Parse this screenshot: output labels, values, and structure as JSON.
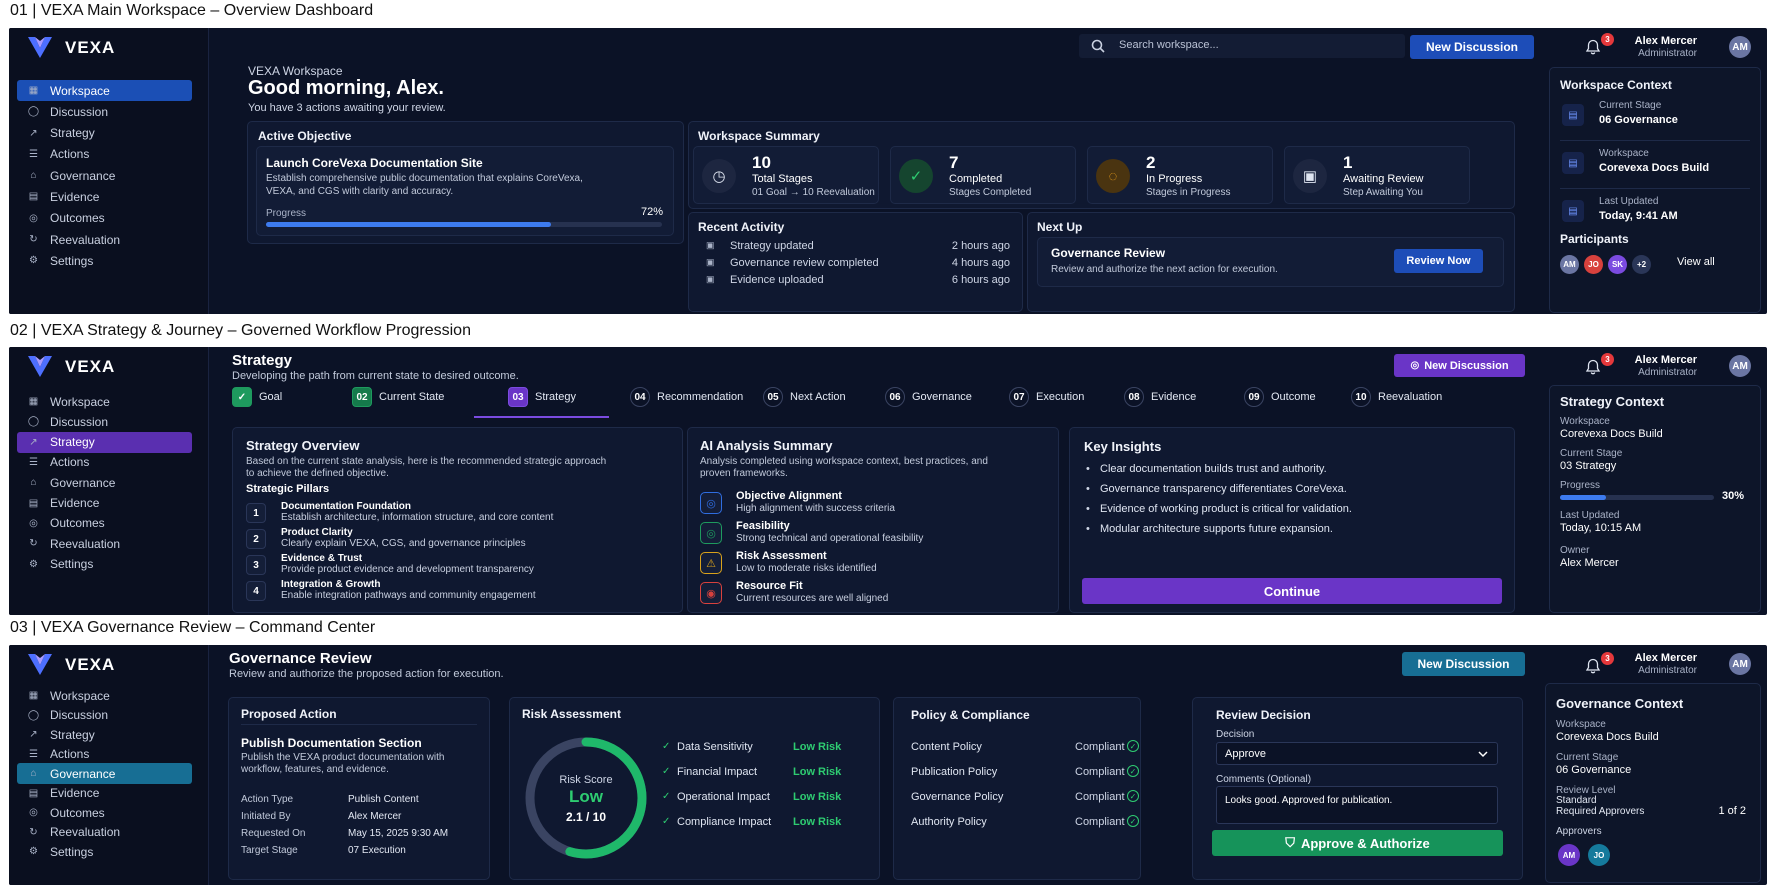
{
  "colors": {
    "blue": "#2f6de0",
    "purple": "#6a35c7",
    "teal": "#157a9c",
    "green": "#1e9a5e",
    "risk_green": "#2ecc71",
    "panel_bg": "#0b1226"
  },
  "brand": "VEXA",
  "nav_items": [
    "Workspace",
    "Discussion",
    "Strategy",
    "Actions",
    "Governance",
    "Evidence",
    "Outcomes",
    "Reevaluation",
    "Settings"
  ],
  "user": {
    "name": "Alex Mercer",
    "role": "Administrator",
    "initials": "AM",
    "notifications": "3"
  },
  "s1": {
    "title": "01  |  VEXA Main Workspace – Overview Dashboard",
    "search_placeholder": "Search workspace...",
    "new_discussion": "New Discussion",
    "eyebrow": "VEXA Workspace",
    "greeting": "Good morning, Alex.",
    "subtext": "You have 3 actions awaiting your review.",
    "objective": {
      "header": "Active Objective",
      "title": "Launch CoreVexa Documentation Site",
      "desc1": "Establish comprehensive public documentation that explains CoreVexa,",
      "desc2": "VEXA, and CGS with clarity and accuracy.",
      "progress_label": "Progress",
      "progress_value": "72%",
      "progress": 0.72
    },
    "summary": {
      "header": "Workspace Summary",
      "stats": [
        {
          "value": "10",
          "label": "Total Stages",
          "sub": "01 Goal → 10 Reevaluation",
          "icon": "stages-icon"
        },
        {
          "value": "7",
          "label": "Completed",
          "sub": "Stages Completed",
          "icon": "check-icon"
        },
        {
          "value": "2",
          "label": "In Progress",
          "sub": "Stages in Progress",
          "icon": "progress-icon"
        },
        {
          "value": "1",
          "label": "Awaiting Review",
          "sub": "Step Awaiting You",
          "icon": "review-icon"
        }
      ]
    },
    "activity": {
      "header": "Recent Activity",
      "items": [
        {
          "text": "Strategy updated",
          "time": "2 hours ago"
        },
        {
          "text": "Governance review completed",
          "time": "4 hours ago"
        },
        {
          "text": "Evidence uploaded",
          "time": "6 hours ago"
        }
      ]
    },
    "next": {
      "header": "Next Up",
      "title": "Governance Review",
      "desc": "Review and authorize the next action for execution.",
      "button": "Review Now"
    },
    "context": {
      "header": "Workspace Context",
      "items": [
        {
          "label": "Current Stage",
          "value": "06 Governance"
        },
        {
          "label": "Workspace",
          "value": "Corevexa Docs Build"
        },
        {
          "label": "Last Updated",
          "value": "Today, 9:41 AM"
        }
      ],
      "participants_label": "Participants",
      "participants": [
        "AM",
        "JO",
        "SK",
        "+2"
      ],
      "view_all": "View all"
    }
  },
  "s2": {
    "title": "02  |  VEXA Strategy & Journey – Governed Workflow Progression",
    "header": "Strategy",
    "subheader": "Developing the path from current state to desired outcome.",
    "new_discussion": "New Discussion",
    "steps": [
      {
        "num": "✓",
        "label": "Goal"
      },
      {
        "num": "02",
        "label": "Current State"
      },
      {
        "num": "03",
        "label": "Strategy"
      },
      {
        "num": "04",
        "label": "Recommendation"
      },
      {
        "num": "05",
        "label": "Next Action"
      },
      {
        "num": "06",
        "label": "Governance"
      },
      {
        "num": "07",
        "label": "Execution"
      },
      {
        "num": "08",
        "label": "Evidence"
      },
      {
        "num": "09",
        "label": "Outcome"
      },
      {
        "num": "10",
        "label": "Reevaluation"
      }
    ],
    "overview": {
      "header": "Strategy Overview",
      "desc1": "Based on the current state analysis, here is the recommended strategic approach",
      "desc2": "to achieve the defined objective.",
      "pillars_label": "Strategic Pillars",
      "pillars": [
        {
          "n": "1",
          "title": "Documentation Foundation",
          "desc": "Establish architecture, information structure, and core content"
        },
        {
          "n": "2",
          "title": "Product Clarity",
          "desc": "Clearly explain VEXA, CGS, and governance principles"
        },
        {
          "n": "3",
          "title": "Evidence & Trust",
          "desc": "Provide product evidence and development transparency"
        },
        {
          "n": "4",
          "title": "Integration & Growth",
          "desc": "Enable integration pathways and community engagement"
        }
      ]
    },
    "ai": {
      "header": "AI Analysis Summary",
      "desc1": "Analysis completed using workspace context, best practices, and",
      "desc2": "proven frameworks.",
      "items": [
        {
          "title": "Objective Alignment",
          "desc": "High alignment with success criteria",
          "color": "#2f6de0"
        },
        {
          "title": "Feasibility",
          "desc": "Strong technical and operational feasibility",
          "color": "#1e9a5e"
        },
        {
          "title": "Risk Assessment",
          "desc": "Low to moderate risks identified",
          "color": "#d9a21b"
        },
        {
          "title": "Resource Fit",
          "desc": "Current resources are well aligned",
          "color": "#d8413d"
        }
      ]
    },
    "insights": {
      "header": "Key Insights",
      "items": [
        "Clear documentation builds trust and authority.",
        "Governance transparency differentiates CoreVexa.",
        "Evidence of working product is critical for validation.",
        "Modular architecture supports future expansion."
      ],
      "button": "Continue"
    },
    "context": {
      "header": "Strategy Context",
      "workspace_label": "Workspace",
      "workspace": "Corevexa Docs Build",
      "stage_label": "Current Stage",
      "stage": "03 Strategy",
      "progress_label": "Progress",
      "progress_value": "30%",
      "progress": 0.3,
      "updated_label": "Last Updated",
      "updated": "Today, 10:15 AM",
      "owner_label": "Owner",
      "owner": "Alex Mercer"
    }
  },
  "s3": {
    "title": "03  |  VEXA Governance Review – Command Center",
    "header": "Governance Review",
    "subheader": "Review and authorize the proposed action for execution.",
    "new_discussion": "New Discussion",
    "proposed": {
      "header": "Proposed Action",
      "title": "Publish Documentation Section",
      "desc1": "Publish the VEXA product documentation with",
      "desc2": "workflow, features, and evidence.",
      "rows": [
        {
          "k": "Action Type",
          "v": "Publish Content"
        },
        {
          "k": "Initiated By",
          "v": "Alex Mercer"
        },
        {
          "k": "Requested On",
          "v": "May 15, 2025 9:30 AM"
        },
        {
          "k": "Target Stage",
          "v": "07 Execution"
        }
      ]
    },
    "risk": {
      "header": "Risk Assessment",
      "score_label": "Risk Score",
      "level": "Low",
      "score": "2.1 / 10",
      "score_value": 2.1,
      "items": [
        {
          "k": "Data Sensitivity",
          "v": "Low Risk"
        },
        {
          "k": "Financial Impact",
          "v": "Low Risk"
        },
        {
          "k": "Operational Impact",
          "v": "Low Risk"
        },
        {
          "k": "Compliance Impact",
          "v": "Low Risk"
        }
      ]
    },
    "policy": {
      "header": "Policy & Compliance",
      "items": [
        {
          "k": "Content Policy",
          "v": "Compliant"
        },
        {
          "k": "Publication Policy",
          "v": "Compliant"
        },
        {
          "k": "Governance Policy",
          "v": "Compliant"
        },
        {
          "k": "Authority Policy",
          "v": "Compliant"
        }
      ]
    },
    "decision": {
      "header": "Review Decision",
      "decision_label": "Decision",
      "decision_value": "Approve",
      "comments_label": "Comments (Optional)",
      "comments": "Looks good. Approved for publication.",
      "button": "Approve & Authorize"
    },
    "context": {
      "header": "Governance Context",
      "workspace_label": "Workspace",
      "workspace": "Corevexa Docs Build",
      "stage_label": "Current Stage",
      "stage": "06 Governance",
      "review_label": "Review Level",
      "review": "Standard",
      "approvers_req_label": "Required Approvers",
      "approvers_req": "1 of 2",
      "approvers_label": "Approvers",
      "approvers": [
        "AM",
        "JO"
      ]
    }
  }
}
